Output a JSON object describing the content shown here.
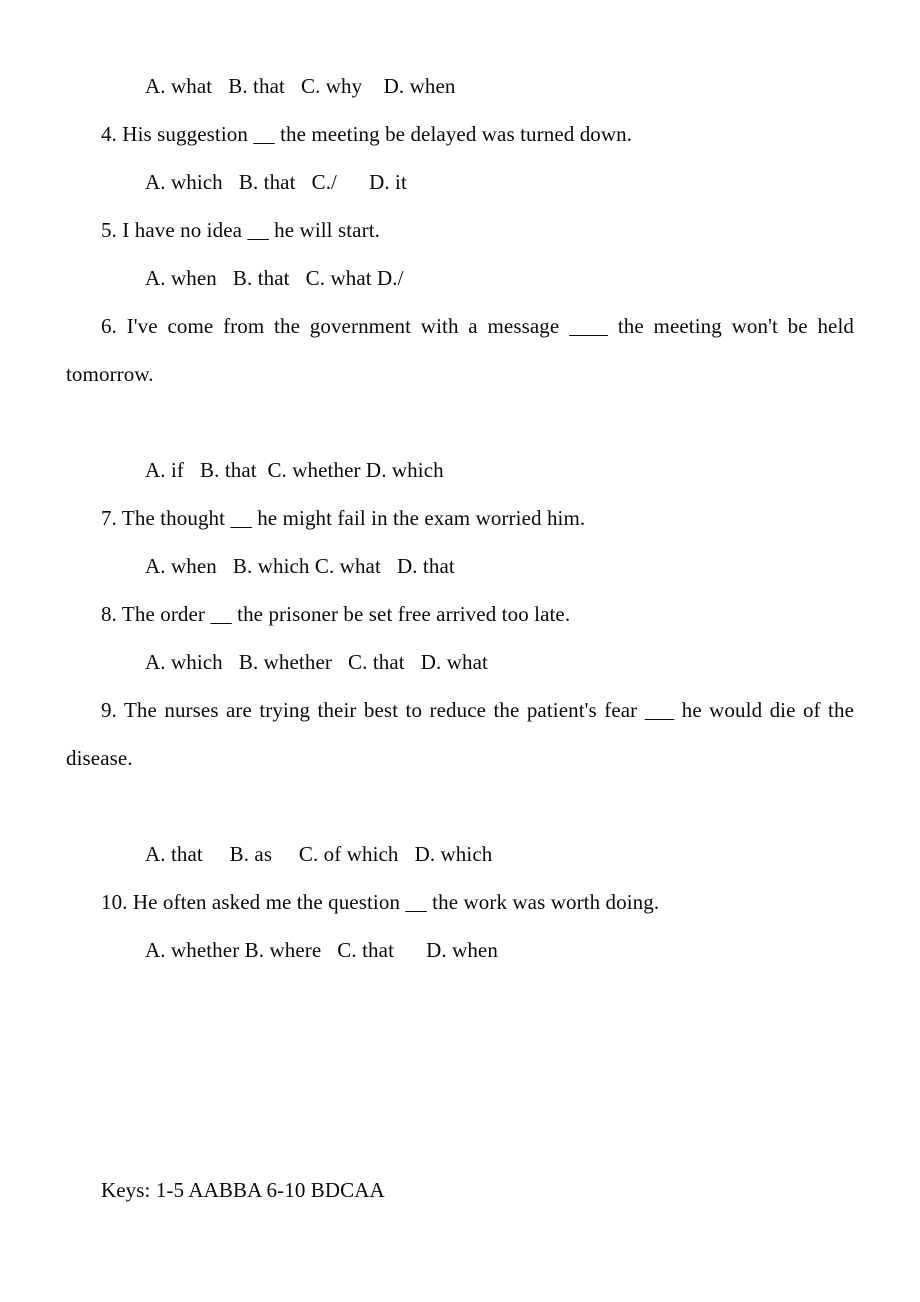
{
  "document": {
    "type": "english-grammar-worksheet",
    "page_background": "#ffffff",
    "text_color": "#0a0a0a"
  },
  "lines": {
    "q3_options": "A. what   B. that   C. why    D. when",
    "q4_stem": "4. His suggestion ____ the meeting be delayed was turned down.",
    "q4_options": "A. which   B. that   C./      D. it",
    "q5_stem": "5. I have no idea ____ he will start.",
    "q5_options": "A. when   B. that   C. what D./",
    "q6_stem": "6. I've come from the government with a message ____ the meeting won't be held tomorrow.",
    "q6_options": "A. if   B. that  C. whether D. which",
    "q7_stem": "7. The thought ____ he might fail in the exam worried him.",
    "q7_options": "A. when   B. which C. what   D. that",
    "q8_stem": "8. The order ____ the prisoner be set free arrived too late.",
    "q8_options": "A. which   B. whether   C. that   D. what",
    "q9_stem": "9. The nurses are trying their best to reduce the patient's fear ____ he would die of the disease.",
    "q9_options": "A. that     B. as     C. of which   D. which",
    "q10_stem": "10. He often asked me the question ____ the work was worth doing.",
    "q10_options": "A. whether B. where   C. that      D. when",
    "answer_keys": "Keys: 1-5 AABBA 6-10 BDCAA"
  },
  "questions": [
    {
      "number": "4",
      "stem": "4. His suggestion ____ the meeting be delayed was turned down.",
      "options": [
        "A. which",
        "B. that",
        "C./",
        "D. it"
      ],
      "answer": "B"
    },
    {
      "number": "5",
      "stem": "5. I have no idea ____ he will start.",
      "options": [
        "A. when",
        "B. that",
        "C. what",
        "D./"
      ],
      "answer": "A"
    },
    {
      "number": "6",
      "stem": "6. I've come from the government with a message ____ the meeting won't be held tomorrow.",
      "options": [
        "A. if",
        "B. that",
        "C. whether",
        "D. which"
      ],
      "answer": "B"
    },
    {
      "number": "7",
      "stem": "7. The thought ____ he might fail in the exam worried him.",
      "options": [
        "A. when",
        "B. which",
        "C. what",
        "D. that"
      ],
      "answer": "D"
    },
    {
      "number": "8",
      "stem": "8. The order ____ the prisoner be set free arrived too late.",
      "options": [
        "A. which",
        "B. whether",
        "C. that",
        "D. what"
      ],
      "answer": "C"
    },
    {
      "number": "9",
      "stem": "9. The nurses are trying their best to reduce the patient's fear ____ he would die of the disease.",
      "options": [
        "A. that",
        "B. as",
        "C. of which",
        "D. which"
      ],
      "answer": "A"
    },
    {
      "number": "10",
      "stem": "10. He often asked me the question ____ the work was worth doing.",
      "options": [
        "A. whether",
        "B. where",
        "C. that",
        "D. when"
      ],
      "answer": "A"
    }
  ],
  "keys": {
    "label": "Keys:",
    "range_1_5": "1-5 AABBA",
    "range_6_10": "6-10 BDCAA",
    "full": "Keys: 1-5 AABBA 6-10 BDCAA"
  }
}
